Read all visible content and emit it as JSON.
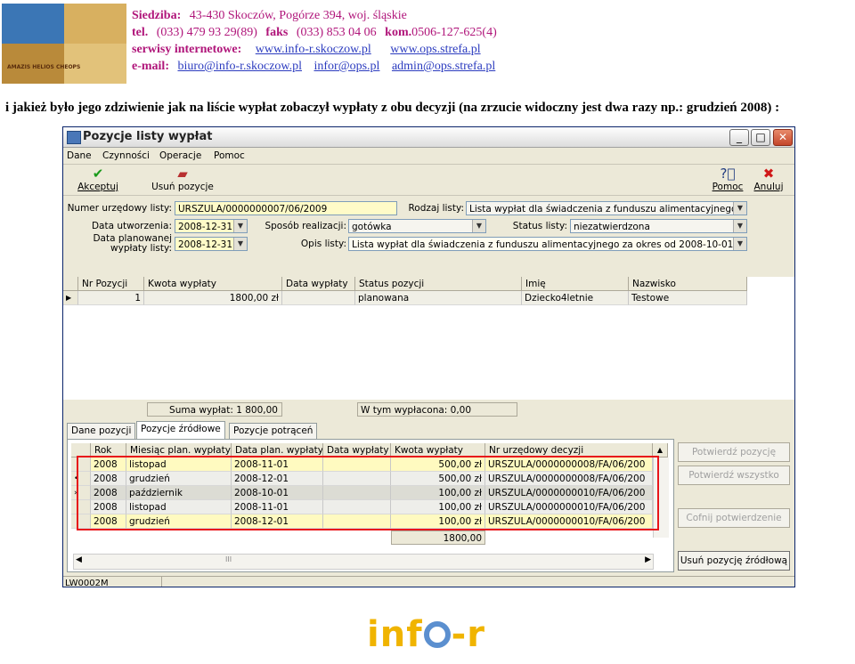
{
  "header": {
    "seat_label": "Siedziba:",
    "seat_value": "43-430 Skoczów,  Pogórze 394,  woj. śląskie",
    "tel_label": "tel.",
    "tel_value": "(033) 479 93 29(89)",
    "fax_label": "faks",
    "fax_value": "(033) 853 04 06",
    "mobile_label": "kom.",
    "mobile_value": "0506-127-625(4)",
    "web_label": "serwisy internetowe:",
    "web_links": [
      "www.info-r.skoczow.pl",
      "www.ops.strefa.pl"
    ],
    "email_label": "e-mail:",
    "email_links": [
      "biuro@info-r.skoczow.pl",
      "infor@ops.pl",
      "admin@ops.strefa.pl"
    ],
    "logo_text": "AMAZIS HELIOS CHEOPS"
  },
  "intro_text": "i jakież było jego zdziwienie jak na liście wypłat zobaczył wypłaty z obu decyzji (na zrzucie widoczny jest dwa razy np.: grudzień 2008) :",
  "window": {
    "title": "Pozycje listy wypłat",
    "controls": [
      "_",
      "□",
      "✕"
    ],
    "menu": [
      "Dane",
      "Czynności",
      "Operacje",
      "Pomoc"
    ],
    "toolbar": {
      "accept": "Akceptuj",
      "remove": "Usuń pozycje",
      "help": "Pomoc",
      "cancel": "Anuluj"
    },
    "form": {
      "official_number_label": "Numer urzędowy listy:",
      "official_number_value": "URSZULA/0000000007/06/2009",
      "list_type_label": "Rodzaj listy:",
      "list_type_value": "Lista wypłat dla świadczenia z funduszu alimentacyjnego",
      "created_label": "Data utworzenia:",
      "created_value": "2008-12-31",
      "method_label": "Sposób realizacji:",
      "method_value": "gotówka",
      "status_label": "Status listy:",
      "status_value": "niezatwierdzona",
      "planned_label_1": "Data planowanej",
      "planned_label_2": "wypłaty listy:",
      "planned_value": "2008-12-31",
      "desc_label": "Opis listy:",
      "desc_value": "Lista wypłat dla świadczenia z funduszu alimentacyjnego za okres od 2008-10-01"
    },
    "positions_table": {
      "columns": [
        "Nr Pozycji",
        "Kwota wypłaty",
        "Data wypłaty",
        "Status pozycji",
        "Imię",
        "Nazwisko"
      ],
      "rows": [
        {
          "nr": "1",
          "amount": "1800,00 zł",
          "date": "",
          "status": "planowana",
          "first": "Dziecko4letnie",
          "last": "Testowe"
        }
      ]
    },
    "sum_label": "Suma wypłat: 1 800,00",
    "paid_label": "W tym wypłacona: 0,00",
    "tabs": [
      "Dane pozycji",
      "Pozycje źródłowe",
      "Pozycje potrąceń"
    ],
    "source_table": {
      "columns": [
        "Rok",
        "Miesiąc plan. wypłaty",
        "Data plan. wypłaty",
        "Data wypłaty",
        "Kwota wypłaty",
        "Nr urzędowy decyzji"
      ],
      "rows": [
        {
          "year": "2008",
          "month": "listopad",
          "plan_date": "2008-11-01",
          "pay_date": "",
          "amount": "500,00 zł",
          "decision": "URSZULA/0000000008/FA/06/200"
        },
        {
          "year": "2008",
          "month": "grudzień",
          "plan_date": "2008-12-01",
          "pay_date": "",
          "amount": "500,00 zł",
          "decision": "URSZULA/0000000008/FA/06/200"
        },
        {
          "year": "2008",
          "month": "październik",
          "plan_date": "2008-10-01",
          "pay_date": "",
          "amount": "100,00 zł",
          "decision": "URSZULA/0000000010/FA/06/200"
        },
        {
          "year": "2008",
          "month": "listopad",
          "plan_date": "2008-11-01",
          "pay_date": "",
          "amount": "100,00 zł",
          "decision": "URSZULA/0000000010/FA/06/200"
        },
        {
          "year": "2008",
          "month": "grudzień",
          "plan_date": "2008-12-01",
          "pay_date": "",
          "amount": "100,00 zł",
          "decision": "URSZULA/0000000010/FA/06/200"
        }
      ],
      "total": "1800,00"
    },
    "side_buttons": {
      "confirm": "Potwierdź pozycję",
      "confirm_all": "Potwierdź wszystko",
      "undo": "Cofnij potwierdzenie",
      "remove_source": "Usuń pozycję źródłową"
    },
    "status_code": "LW0002M",
    "scroll_mark": "III",
    "highlight_color": "#e8151b"
  },
  "footer": {
    "logo_left": "inf",
    "logo_right": "-r"
  }
}
